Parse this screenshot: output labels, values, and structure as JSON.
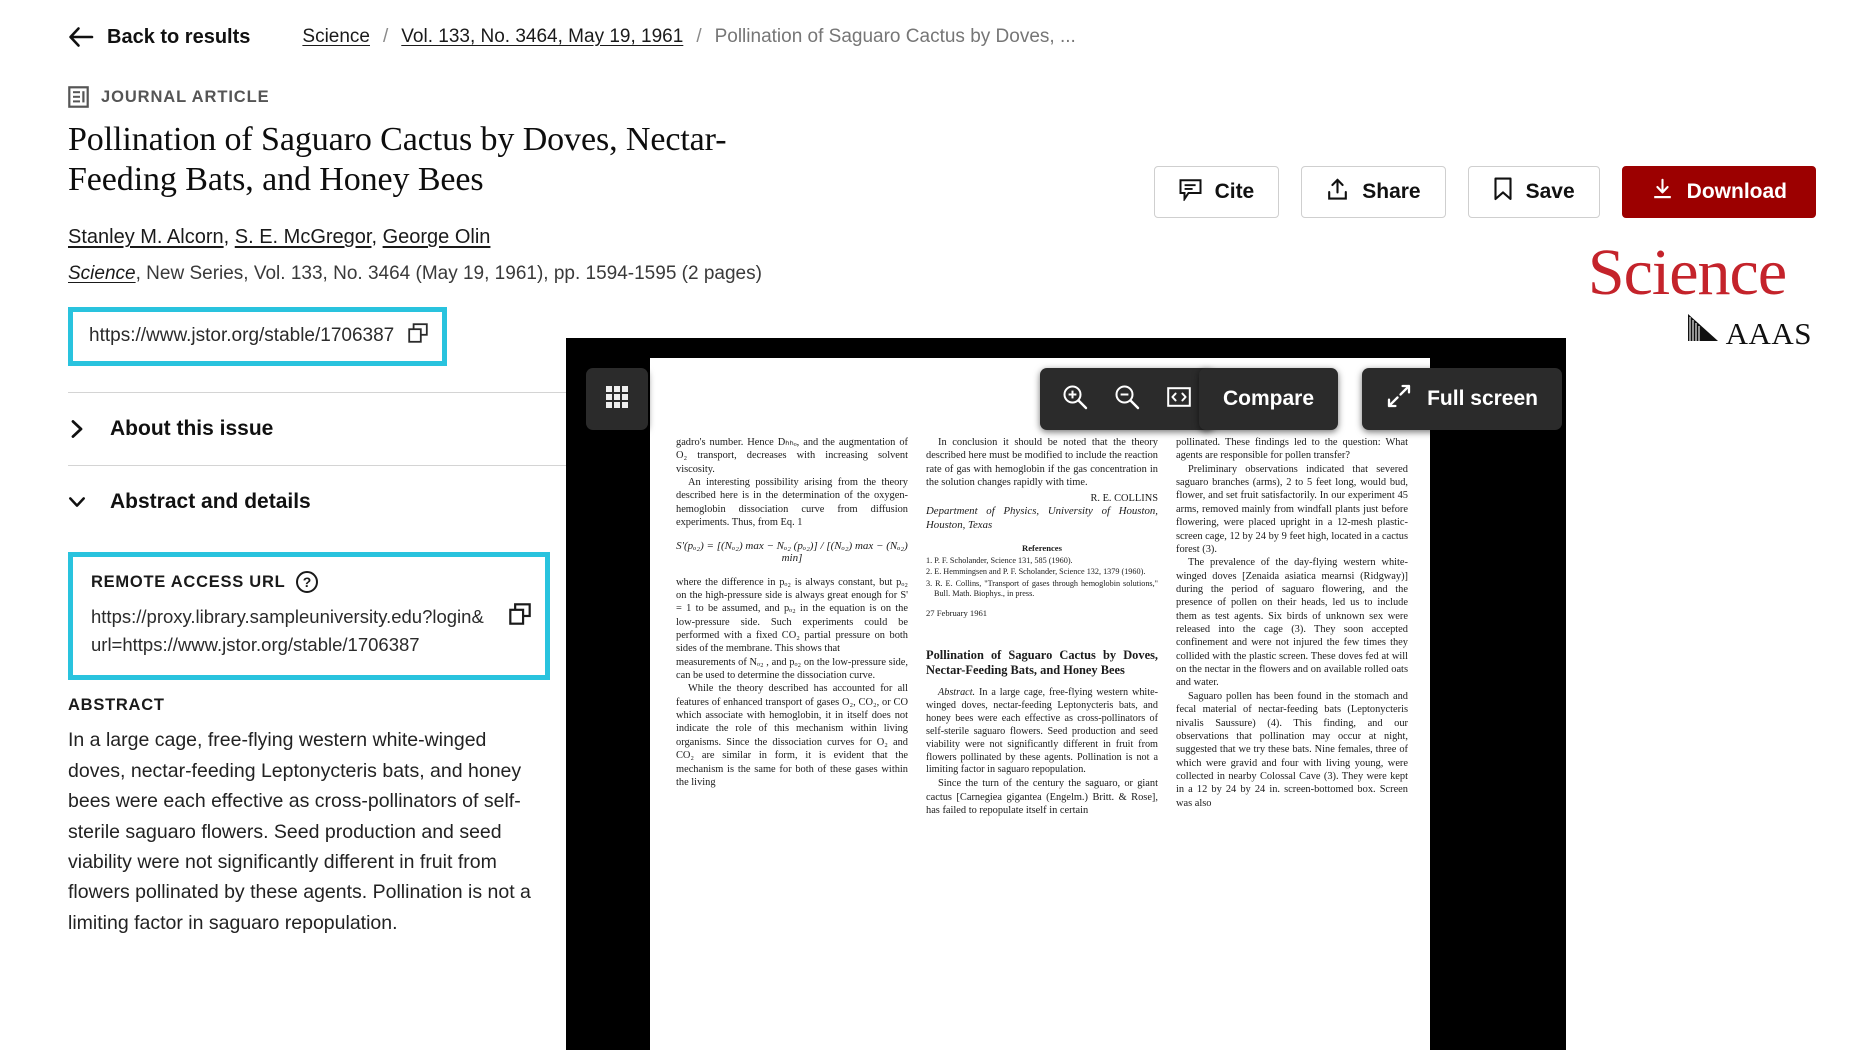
{
  "nav": {
    "back_label": "Back to results",
    "back_icon": "arrow-left-icon",
    "breadcrumb": [
      {
        "label": "Science",
        "type": "link"
      },
      {
        "label": "Vol. 133, No. 3464, May 19, 1961",
        "type": "link"
      },
      {
        "label": "Pollination of Saguaro Cactus by Doves, ...",
        "type": "current"
      }
    ],
    "separator": "/"
  },
  "article": {
    "kicker": "JOURNAL ARTICLE",
    "kicker_icon": "document-icon",
    "title": "Pollination of Saguaro Cactus by Doves, Nectar-Feeding Bats, and Honey Bees",
    "authors": [
      "Stanley M. Alcorn",
      "S. E. McGregor",
      "George Olin"
    ],
    "author_separator": ", ",
    "citation": {
      "journal": "Science",
      "rest": ", New Series, Vol. 133, No. 3464 (May 19, 1961), pp. 1594-1595 (2 pages)"
    },
    "stable_url": "https://www.jstor.org/stable/1706387",
    "copy_icon": "copy-icon"
  },
  "highlight_color": "#29c3de",
  "accordions": [
    {
      "label": "About this issue",
      "state": "collapsed",
      "icon": "chevron-right-icon"
    },
    {
      "label": "Abstract and details",
      "state": "expanded",
      "icon": "chevron-down-icon"
    }
  ],
  "remote_access": {
    "heading": "REMOTE ACCESS URL",
    "help_icon": "question-circle-icon",
    "help_glyph": "?",
    "url": "https://proxy.library.sampleuniversity.edu?login&url=https://www.jstor.org/stable/1706387",
    "copy_icon": "copy-icon"
  },
  "abstract": {
    "heading": "ABSTRACT",
    "text": "In a large cage, free-flying western white-winged doves, nectar-feeding Leptonycteris bats, and honey bees were each effective as cross-pollinators of self-sterile saguaro flowers. Seed production and seed viability were not significantly different in fruit from flowers pollinated by these agents. Pollination is not a limiting factor in saguaro repopulation."
  },
  "actions": [
    {
      "label": "Cite",
      "icon": "quote-bubble-icon",
      "style": "secondary"
    },
    {
      "label": "Share",
      "icon": "share-upload-icon",
      "style": "secondary"
    },
    {
      "label": "Save",
      "icon": "bookmark-icon",
      "style": "secondary"
    },
    {
      "label": "Download",
      "icon": "download-icon",
      "style": "primary"
    }
  ],
  "brand": {
    "name": "Science",
    "publisher": "AAAS",
    "color": "#c4232b"
  },
  "viewer": {
    "grid_icon": "grid-thumbnails-icon",
    "zoom_in_icon": "zoom-in-icon",
    "zoom_out_icon": "zoom-out-icon",
    "fit_width_icon": "fit-width-icon",
    "compare_label": "Compare",
    "fullscreen_label": "Full screen",
    "fullscreen_icon": "expand-arrows-icon"
  },
  "scanned_page": {
    "col1": {
      "p1": "gadro's number. Hence Dₕₕₒ, and the augmentation of O₂ transport, decreases with increasing solvent viscosity.",
      "p2": "An interesting possibility arising from the theory described here is in the determination of the oxygen-hemoglobin dissociation curve from diffusion experiments. Thus, from Eq. 1",
      "formula": "S'(pₒ₂) = [(Nₒ₂) max − Nₒ₂ (pₒ₂)] / [(Nₒ₂) max − (Nₒ₂) min]",
      "p3": "where the difference in pₒ₂ is always constant, but pₒ₂ on the high-pressure side is always great enough for S' = 1 to be assumed, and pₒ₂ in the equation is on the low-pressure side. Such experiments could be performed with a fixed CO₂ partial pressure on both sides of the membrane. This shows that",
      "p4": "measurements of Nₒ₂ , and pₒ₂ on the low-pressure side, can be used to determine the dissociation curve.",
      "p5": "While the theory described has accounted for all features of enhanced transport of gases O₂, CO₂, or CO which associate with hemoglobin, it in itself does not indicate the role of this mechanism within living organisms. Since the dissociation curves for O₂ and CO₂ are similar in form, it is evident that the mechanism is the same for both of these gases within the living"
    },
    "col2": {
      "p1": "In conclusion it should be noted that the theory described here must be modified to include the reaction rate of gas with hemoglobin if the gas concentration in the solution changes rapidly with time.",
      "byline": "R. E. COLLINS",
      "affiliation": "Department of Physics, University of Houston, Houston, Texas",
      "refs_heading": "References",
      "refs": [
        "1. P. F. Scholander, Science 131, 585 (1960).",
        "2. E. Hemmingsen and P. F. Scholander, Science 132, 1379 (1960).",
        "3. R. E. Collins, \"Transport of gases through hemoglobin solutions,\" Bull. Math. Biophys., in press."
      ],
      "date": "27 February 1961",
      "article_title": "Pollination of Saguaro Cactus by Doves, Nectar-Feeding Bats, and Honey Bees",
      "abstract_lead": "Abstract.",
      "abstract_body": "In a large cage, free-flying western white-winged doves, nectar-feeding Leptonycteris bats, and honey bees were each effective as cross-pollinators of self-sterile saguaro flowers. Seed production and seed viability were not significantly different in fruit from flowers pollinated by these agents. Pollination is not a limiting factor in saguaro repopulation.",
      "p_last": "Since the turn of the century the saguaro, or giant cactus [Carnegiea gigantea (Engelm.) Britt. & Rose], has failed to repopulate itself in certain"
    },
    "col3": {
      "p1": "pollinated. These findings led to the question: What agents are responsible for pollen transfer?",
      "p2": "Preliminary observations indicated that severed saguaro branches (arms), 2 to 5 feet long, would bud, flower, and set fruit satisfactorily. In our experiment 45 arms, removed mainly from windfall plants just before flowering, were placed upright in a 12-mesh plastic-screen cage, 12 by 24 by 9 feet high, located in a cactus forest (3).",
      "p3": "The prevalence of the day-flying western white-winged doves [Zenaida asiatica mearnsi (Ridgway)] during the period of saguaro flowering, and the presence of pollen on their heads, led us to include them as test agents. Six birds of unknown sex were released into the cage (3). They soon accepted confinement and were not injured the few times they collided with the plastic screen. These doves fed at will on the nectar in the flowers and on available rolled oats and water.",
      "p4": "Saguaro pollen has been found in the stomach and fecal material of nectar-feeding bats (Leptonycteris nivalis Saussure) (4). This finding, and our observations that pollination may occur at night, suggested that we try these bats. Nine females, three of which were gravid and four with living young, were collected in nearby Colossal Cave (3). They were kept in a 12 by 24 by 24 in. screen-bottomed box. Screen was also"
    }
  }
}
